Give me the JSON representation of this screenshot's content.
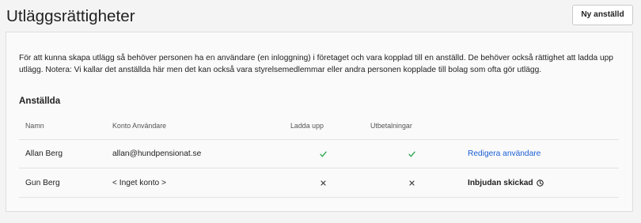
{
  "page": {
    "title": "Utläggsrättigheter",
    "new_employee_button": "Ny anställd"
  },
  "info": {
    "text": "För att kunna skapa utlägg så behöver personen ha en användare (en inloggning) i företaget och vara kopplad till en anställd. De behöver också rättighet att ladda upp utlägg. Notera: Vi kallar det anställda här men det kan också vara styrelsemedlemmar eller andra personen kopplade till bolag som ofta gör utlägg."
  },
  "employees": {
    "heading": "Anställda",
    "columns": [
      "Namn",
      "Konto Användare",
      "Ladda upp",
      "Utbetalningar"
    ],
    "rows": [
      {
        "name": "Allan Berg",
        "account": "allan@hundpensionat.se",
        "upload": true,
        "payouts": true,
        "action": {
          "link": "Redigera användare"
        }
      },
      {
        "name": "Gun Berg",
        "account": "< Inget konto >",
        "upload": false,
        "payouts": false,
        "action": {
          "status": "Inbjudan skickad",
          "icon": "clock-icon"
        }
      }
    ]
  },
  "icons": {
    "allowed": "check-icon",
    "denied": "cross-icon"
  },
  "colors": {
    "link": "#1a5fd6",
    "check": "#2fa652",
    "cross": "#333333"
  }
}
